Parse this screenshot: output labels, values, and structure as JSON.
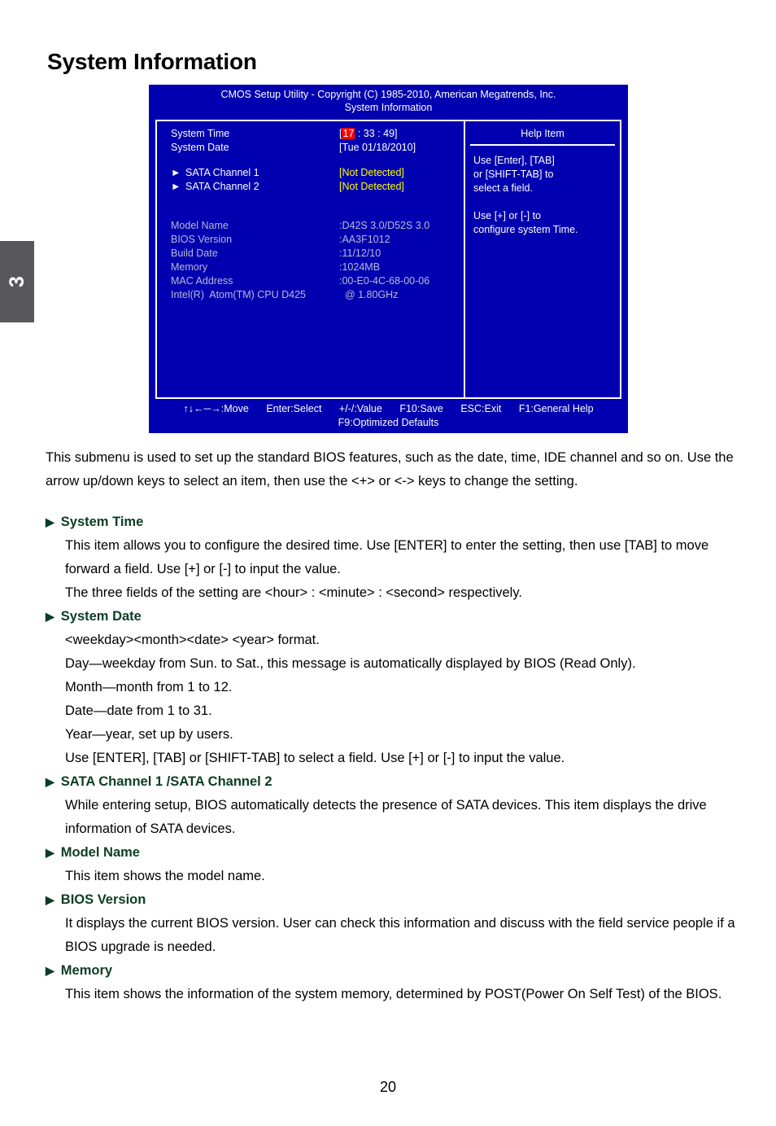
{
  "chapter": {
    "number": "3"
  },
  "page_title": "System Information",
  "page_number": "20",
  "bios": {
    "header_line1": "CMOS Setup Utility - Copyright (C) 1985-2010, American Megatrends, Inc.",
    "header_line2": "System Information",
    "time_row": {
      "label": "System Time",
      "bracket_open": "[",
      "hour": "17",
      "rest": " : 33 : 49]"
    },
    "date_row": {
      "label": "System Date",
      "value": "[Tue 01/18/2010]"
    },
    "sata": [
      {
        "arrow": "►",
        "label": "SATA Channel 1",
        "value": "[Not Detected]"
      },
      {
        "arrow": "►",
        "label": "SATA Channel 2",
        "value": "[Not Detected]"
      }
    ],
    "info": [
      {
        "label": "Model Name",
        "value": ":D42S 3.0/D52S 3.0"
      },
      {
        "label": "BIOS Version",
        "value": ":AA3F1012"
      },
      {
        "label": "Build Date",
        "value": ":11/12/10"
      },
      {
        "label": "Memory",
        "value": ":1024MB"
      },
      {
        "label": "MAC Address",
        "value": ":00-E0-4C-68-00-06"
      },
      {
        "label": "Intel(R)  Atom(TM) CPU D425",
        "value": "  @ 1.80GHz"
      }
    ],
    "help": {
      "title": "Help Item",
      "line1": "Use [Enter], [TAB]",
      "line2": "or [SHIFT-TAB] to",
      "line3": "select a field.",
      "line4": "Use [+] or [-] to",
      "line5": "configure system Time."
    },
    "footer": {
      "move": "↑↓←─→:Move",
      "select": "Enter:Select",
      "value": "+/-/:Value",
      "save": "F10:Save",
      "exit": "ESC:Exit",
      "help": "F1:General Help",
      "defaults": "F9:Optimized Defaults"
    },
    "colors": {
      "background": "#0000b0",
      "highlight": "#ff0000",
      "value_yellow": "#ffff00",
      "dim_text": "#b9b9d8"
    }
  },
  "doc": {
    "intro": "This submenu is used to set up the standard BIOS features, such as the date, time, IDE channel and so on. Use the arrow up/down keys to select an item, then use the <+> or <-> keys to change the setting.",
    "sections": [
      {
        "heading": "System Time",
        "lines": [
          "This item allows you to configure the desired time. Use [ENTER] to enter the setting, then use [TAB] to move forward a field. Use [+] or [-] to input the value.",
          "The three fields of the setting are <hour> : <minute> : <second> respectively."
        ]
      },
      {
        "heading": "System Date",
        "lines": [
          "<weekday><month><date> <year> format.",
          "Day—weekday from Sun. to Sat., this message is automatically displayed by BIOS (Read Only).",
          "Month—month from 1 to 12.",
          "Date—date from 1 to 31.",
          "Year—year, set up by users.",
          "Use [ENTER], [TAB] or [SHIFT-TAB] to select a field. Use [+] or [-] to input the value."
        ]
      },
      {
        "heading": "SATA Channel 1 /SATA Channel 2",
        "lines": [
          "While entering setup, BIOS automatically detects the presence of SATA devices. This item displays the drive information of SATA devices."
        ]
      },
      {
        "heading": "Model Name",
        "lines": [
          "This item shows the model name."
        ]
      },
      {
        "heading": "BIOS Version",
        "lines": [
          "It displays the current BIOS version. User can check this information and discuss with the field service people if a BIOS upgrade is needed."
        ]
      },
      {
        "heading": "Memory",
        "lines": [
          "This item shows the information of the system memory, determined by POST(Power On Self Test) of the BIOS."
        ]
      }
    ],
    "bullet_glyph": "▶",
    "heading_color": "#0b3d26"
  }
}
